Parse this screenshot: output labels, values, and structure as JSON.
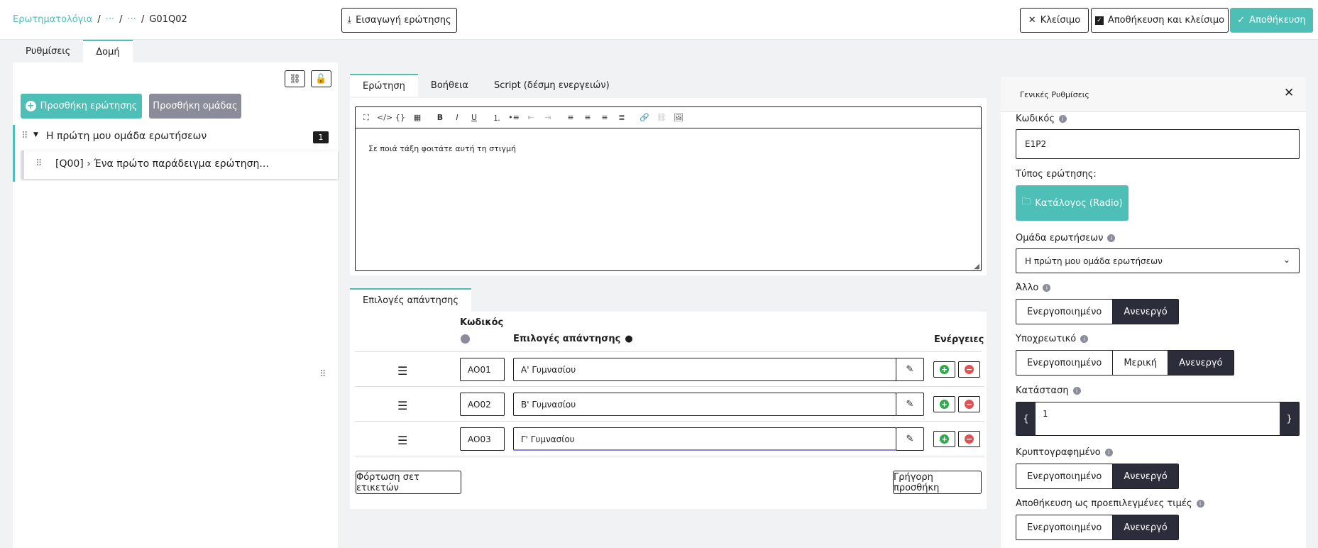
{
  "breadcrumb": {
    "root": "Ερωτηματολόγια",
    "sep": "/",
    "ellipsis1": "···",
    "ellipsis2": "···",
    "current": "G01Q02"
  },
  "header": {
    "import_label": "Εισαγωγή ερώτησης",
    "close_label": "Κλείσιμο",
    "save_close_label": "Αποθήκευση και κλείσιμο",
    "save_label": "Αποθήκευση"
  },
  "top_tabs": [
    {
      "label": "Ρυθμίσεις"
    },
    {
      "label": "Δομή"
    }
  ],
  "structure": {
    "add_question": "Προσθήκη ερώτησης",
    "add_group": "Προσθήκη ομάδας",
    "group_name": "Η πρώτη μου ομάδα ερωτήσεων",
    "group_count": "1",
    "question_item": "[Q00] › Ένα πρώτο παράδειγμα ερώτηση..."
  },
  "editor": {
    "tabs": [
      {
        "label": "Ερώτηση"
      },
      {
        "label": "Βοήθεια"
      },
      {
        "label": "Script (δέσμη ενεργειών)"
      }
    ],
    "content": "Σε ποιά τάξη φοιτάτε αυτή τη στιγμή"
  },
  "answers": {
    "tab": "Επιλογές απάντησης",
    "col_code": "Κωδικός",
    "col_options": "Επιλογές απάντησης",
    "col_actions": "Ενέργειες",
    "rows": [
      {
        "code": "AO01",
        "text": "Α' Γυμνασίου"
      },
      {
        "code": "AO02",
        "text": "Β' Γυμνασίου"
      },
      {
        "code": "AO03",
        "text": "Γ' Γυμνασίου"
      }
    ],
    "load_label_set": "Φόρτωση σετ ετικετών",
    "quick_add": "Γρήγορη προσθήκη"
  },
  "settings": {
    "title": "Γενικές Ρυθμίσεις",
    "code_label": "Κωδικός",
    "code_value": "E1P2",
    "type_label": "Τύπος ερώτησης:",
    "type_value": "Κατάλογος (Radio)",
    "group_label": "Ομάδα ερωτήσεων",
    "group_value": "Η πρώτη μου ομάδα ερωτήσεων",
    "other_label": "Άλλο",
    "mandatory_label": "Υποχρεωτικό",
    "condition_label": "Κατάσταση",
    "condition_value": "1",
    "encrypted_label": "Κρυπτογραφημένο",
    "save_default_label": "Αποθήκευση ως προεπιλεγμένες τιμές",
    "on": "Ενεργοποιημένο",
    "off": "Ανενεργό",
    "partial": "Μερική"
  },
  "colors": {
    "accent": "#4dbfb7",
    "dark": "#2b2d3a"
  }
}
